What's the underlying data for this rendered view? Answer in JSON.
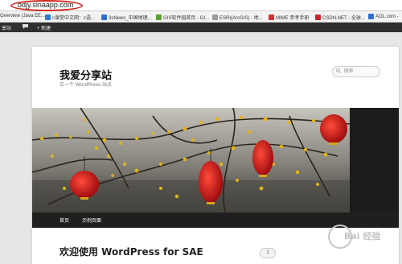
{
  "browser": {
    "address": "bdjy.sinaapp.com",
    "bookmarks": [
      {
        "label": "Overview (Java EE...",
        "color": "#3d6bb3"
      },
      {
        "label": "c课堂中文网：c语...",
        "color": "#2d7bd1"
      },
      {
        "label": "3sNews_中国地理...",
        "color": "#2f6fcf"
      },
      {
        "label": "GIS软件园首页 - GI...",
        "color": "#5aa02c"
      },
      {
        "label": "ESRI(ArcGIS) - 地...",
        "color": "#9b9b9b"
      },
      {
        "label": "MIME 参考手册",
        "color": "#d12f2f"
      },
      {
        "label": "CSDN.NET - 全球...",
        "color": "#c9272e"
      },
      {
        "label": "AOL.com -",
        "color": "#2f6fcf"
      }
    ]
  },
  "admin_bar": {
    "share_label": "享站",
    "comment_icon": "comment-icon",
    "new_label": "+ 新建"
  },
  "site": {
    "title": "我爱分享站",
    "description": "又一个 WordPress 站点",
    "search_placeholder": "搜索"
  },
  "nav": {
    "items": [
      "首页",
      "示例页面"
    ]
  },
  "post": {
    "title": "欢迎使用 WordPress for SAE",
    "comment_count": "1"
  },
  "watermark": {
    "text": "Bai 经验",
    "url": "jingyan.baidu.com"
  }
}
